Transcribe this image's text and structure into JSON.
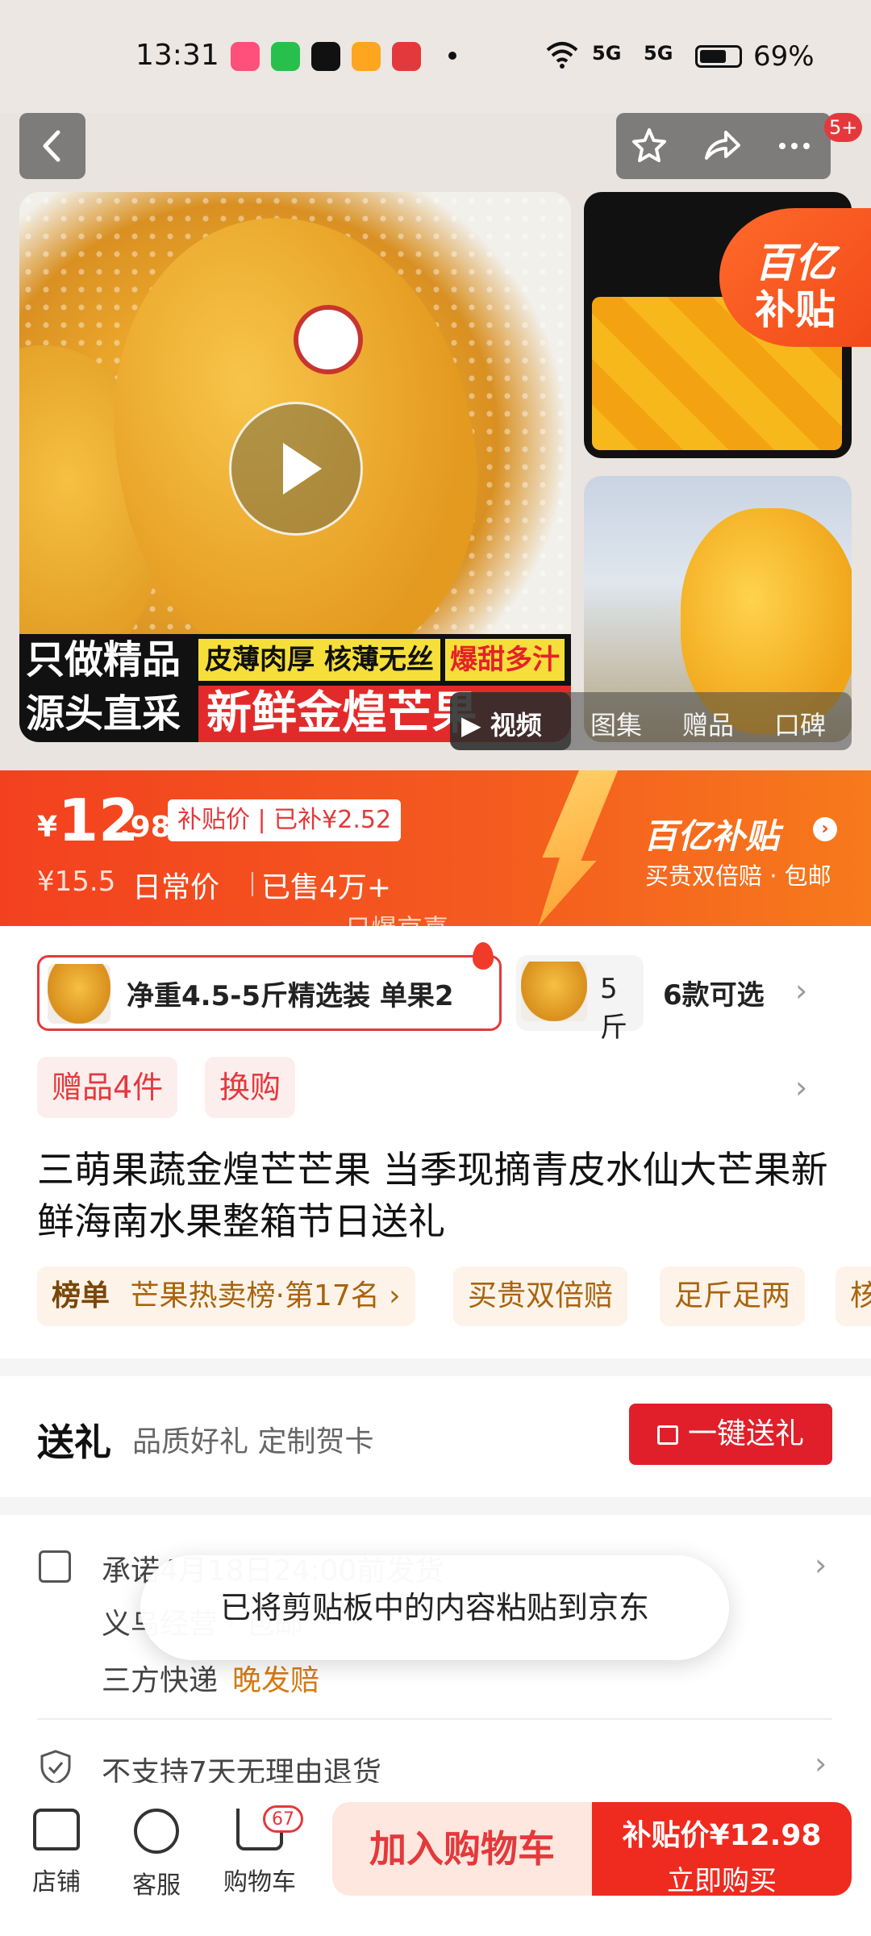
{
  "status_bar": {
    "time": "13:31",
    "signal1": "5G",
    "signal2": "5G",
    "battery_percent": "69%",
    "battery_level": 0.69
  },
  "header": {
    "notification_badge": "5+"
  },
  "gallery": {
    "main_banner": {
      "line1_left": "只做精品",
      "line1_mid": "皮薄肉厚 核薄无丝",
      "line1_hot": "爆甜多汁",
      "line2_left": "源头直采",
      "line2_big": "新鲜金煌芒果"
    },
    "subsidy_corner": {
      "line1": "百亿",
      "line2": "补贴"
    },
    "media_tabs": [
      "▶ 视频",
      "图集",
      "赠品",
      "口碑"
    ]
  },
  "price": {
    "currency": "¥",
    "integer": "12",
    "decimal": ".98",
    "subsidy_tag": "补贴价 | 已补¥2.52",
    "daily_price": "¥15.5",
    "daily_label": "日常价",
    "sold": "已售4万+",
    "program_logo": "百亿补贴",
    "program_sub": "买贵双倍赔 · 包邮",
    "ghost_text": "只爆京喜"
  },
  "variants": {
    "selected": "净重4.5-5斤精选装 单果2",
    "second": "5斤",
    "more": "6款可选"
  },
  "gift_tags": [
    "赠品4件",
    "换购"
  ],
  "product_title": "三萌果蔬金煌芒芒果 当季现摘青皮水仙大芒果新鲜海南水果整箱节日送礼",
  "tags": {
    "rank_label": "榜单",
    "rank_value": "芒果热卖榜·第17名 ›",
    "t1": "买贵双倍赔",
    "t2": "足斤足两",
    "t3": "核"
  },
  "gift_section": {
    "title": "送礼",
    "subtitle": "品质好礼 定制贺卡",
    "button": "一键送礼"
  },
  "services": {
    "promise_line1": "承诺4月18日24:00前发货",
    "promise_line2": "义乌经营 · 包邮",
    "promise_line3_a": "三方快递",
    "promise_line3_b": "晚发赔",
    "returns": "不支持7天无理由退货"
  },
  "toast": "已将剪贴板中的内容粘贴到京东",
  "bottom_bar": {
    "store": "店铺",
    "service": "客服",
    "cart": "购物车",
    "cart_count": "67",
    "add_to_cart": "加入购物车",
    "buy_line1": "补贴价¥12.98",
    "buy_line2": "立即购买"
  }
}
